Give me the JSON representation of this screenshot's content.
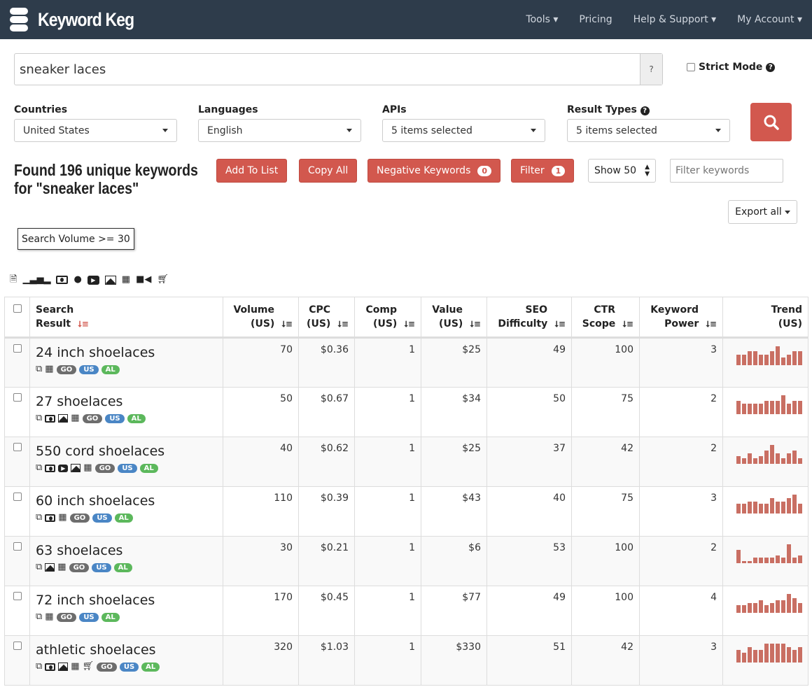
{
  "nav": {
    "brand": "Keyword Keg",
    "menu": [
      "Tools",
      "Pricing",
      "Help & Support",
      "My Account"
    ]
  },
  "search": {
    "value": "sneaker laces",
    "help": "?",
    "strict_mode": "Strict Mode"
  },
  "filters": {
    "countries": {
      "label": "Countries",
      "value": "United States"
    },
    "languages": {
      "label": "Languages",
      "value": "English"
    },
    "apis": {
      "label": "APIs",
      "value": "5 items selected"
    },
    "result_types": {
      "label": "Result Types",
      "value": "5 items selected"
    }
  },
  "results": {
    "line1": "Found 196 unique keywords",
    "line2": "for \"sneaker laces\""
  },
  "toolbar": {
    "add_to_list": "Add To List",
    "copy_all": "Copy All",
    "negative_keywords": "Negative Keywords",
    "negative_count": "0",
    "filter": "Filter",
    "filter_count": "1",
    "show": "Show 50",
    "filter_placeholder": "Filter keywords",
    "export": "Export all"
  },
  "active_filter": "Search Volume >= 30",
  "colors": {
    "accent": "#d2584e",
    "nav": "#2e3c4b",
    "trend": "#c96f63",
    "go": "#6d6d6d",
    "us": "#4a86c5",
    "al": "#5cb85c"
  },
  "table": {
    "headers": [
      [
        "Search",
        "Result"
      ],
      [
        "Volume",
        "(US)"
      ],
      [
        "CPC",
        "(US)"
      ],
      [
        "Comp",
        "(US)"
      ],
      [
        "Value",
        "(US)"
      ],
      [
        "SEO",
        "Difficulty"
      ],
      [
        "CTR",
        "Scope"
      ],
      [
        "Keyword",
        "Power"
      ],
      [
        "Trend",
        "(US)"
      ]
    ],
    "tags": [
      "GO",
      "US",
      "AL"
    ],
    "rows": [
      {
        "keyword": "24 inch shoelaces",
        "icons": [
          "copy",
          "calendar"
        ],
        "volume": "70",
        "cpc": "$0.36",
        "comp": "1",
        "value": "$25",
        "seo": "49",
        "ctr": "100",
        "power": "3",
        "trend": [
          50,
          50,
          68,
          68,
          50,
          50,
          68,
          89,
          38,
          50,
          68,
          68
        ]
      },
      {
        "keyword": "27 shoelaces",
        "icons": [
          "copy",
          "money",
          "image",
          "calendar"
        ],
        "volume": "50",
        "cpc": "$0.67",
        "comp": "1",
        "value": "$34",
        "seo": "50",
        "ctr": "75",
        "power": "2",
        "trend": [
          62,
          50,
          50,
          50,
          50,
          62,
          62,
          62,
          89,
          50,
          62,
          62
        ]
      },
      {
        "keyword": "550 cord shoelaces",
        "icons": [
          "copy",
          "money",
          "youtube",
          "image",
          "calendar"
        ],
        "volume": "40",
        "cpc": "$0.62",
        "comp": "1",
        "value": "$25",
        "seo": "37",
        "ctr": "42",
        "power": "2",
        "trend": [
          38,
          26,
          50,
          26,
          38,
          62,
          89,
          50,
          26,
          50,
          62,
          26
        ]
      },
      {
        "keyword": "60 inch shoelaces",
        "icons": [
          "copy",
          "money",
          "calendar"
        ],
        "volume": "110",
        "cpc": "$0.39",
        "comp": "1",
        "value": "$43",
        "seo": "40",
        "ctr": "75",
        "power": "3",
        "trend": [
          47,
          47,
          56,
          56,
          47,
          47,
          74,
          56,
          56,
          74,
          89,
          47
        ]
      },
      {
        "keyword": "63 shoelaces",
        "icons": [
          "copy",
          "image",
          "calendar"
        ],
        "volume": "30",
        "cpc": "$0.21",
        "comp": "1",
        "value": "$6",
        "seo": "53",
        "ctr": "100",
        "power": "2",
        "trend": [
          62,
          11,
          11,
          26,
          26,
          26,
          26,
          38,
          26,
          89,
          26,
          38
        ]
      },
      {
        "keyword": "72 inch shoelaces",
        "icons": [
          "copy",
          "calendar"
        ],
        "volume": "170",
        "cpc": "$0.45",
        "comp": "1",
        "value": "$77",
        "seo": "49",
        "ctr": "100",
        "power": "4",
        "trend": [
          38,
          38,
          47,
          47,
          59,
          38,
          47,
          59,
          59,
          89,
          71,
          47
        ]
      },
      {
        "keyword": "athletic shoelaces",
        "icons": [
          "copy",
          "money",
          "image",
          "calendar",
          "cart"
        ],
        "volume": "320",
        "cpc": "$1.03",
        "comp": "1",
        "value": "$330",
        "seo": "51",
        "ctr": "42",
        "power": "3",
        "trend": [
          59,
          47,
          74,
          59,
          59,
          89,
          89,
          89,
          89,
          74,
          59,
          74
        ]
      }
    ]
  }
}
